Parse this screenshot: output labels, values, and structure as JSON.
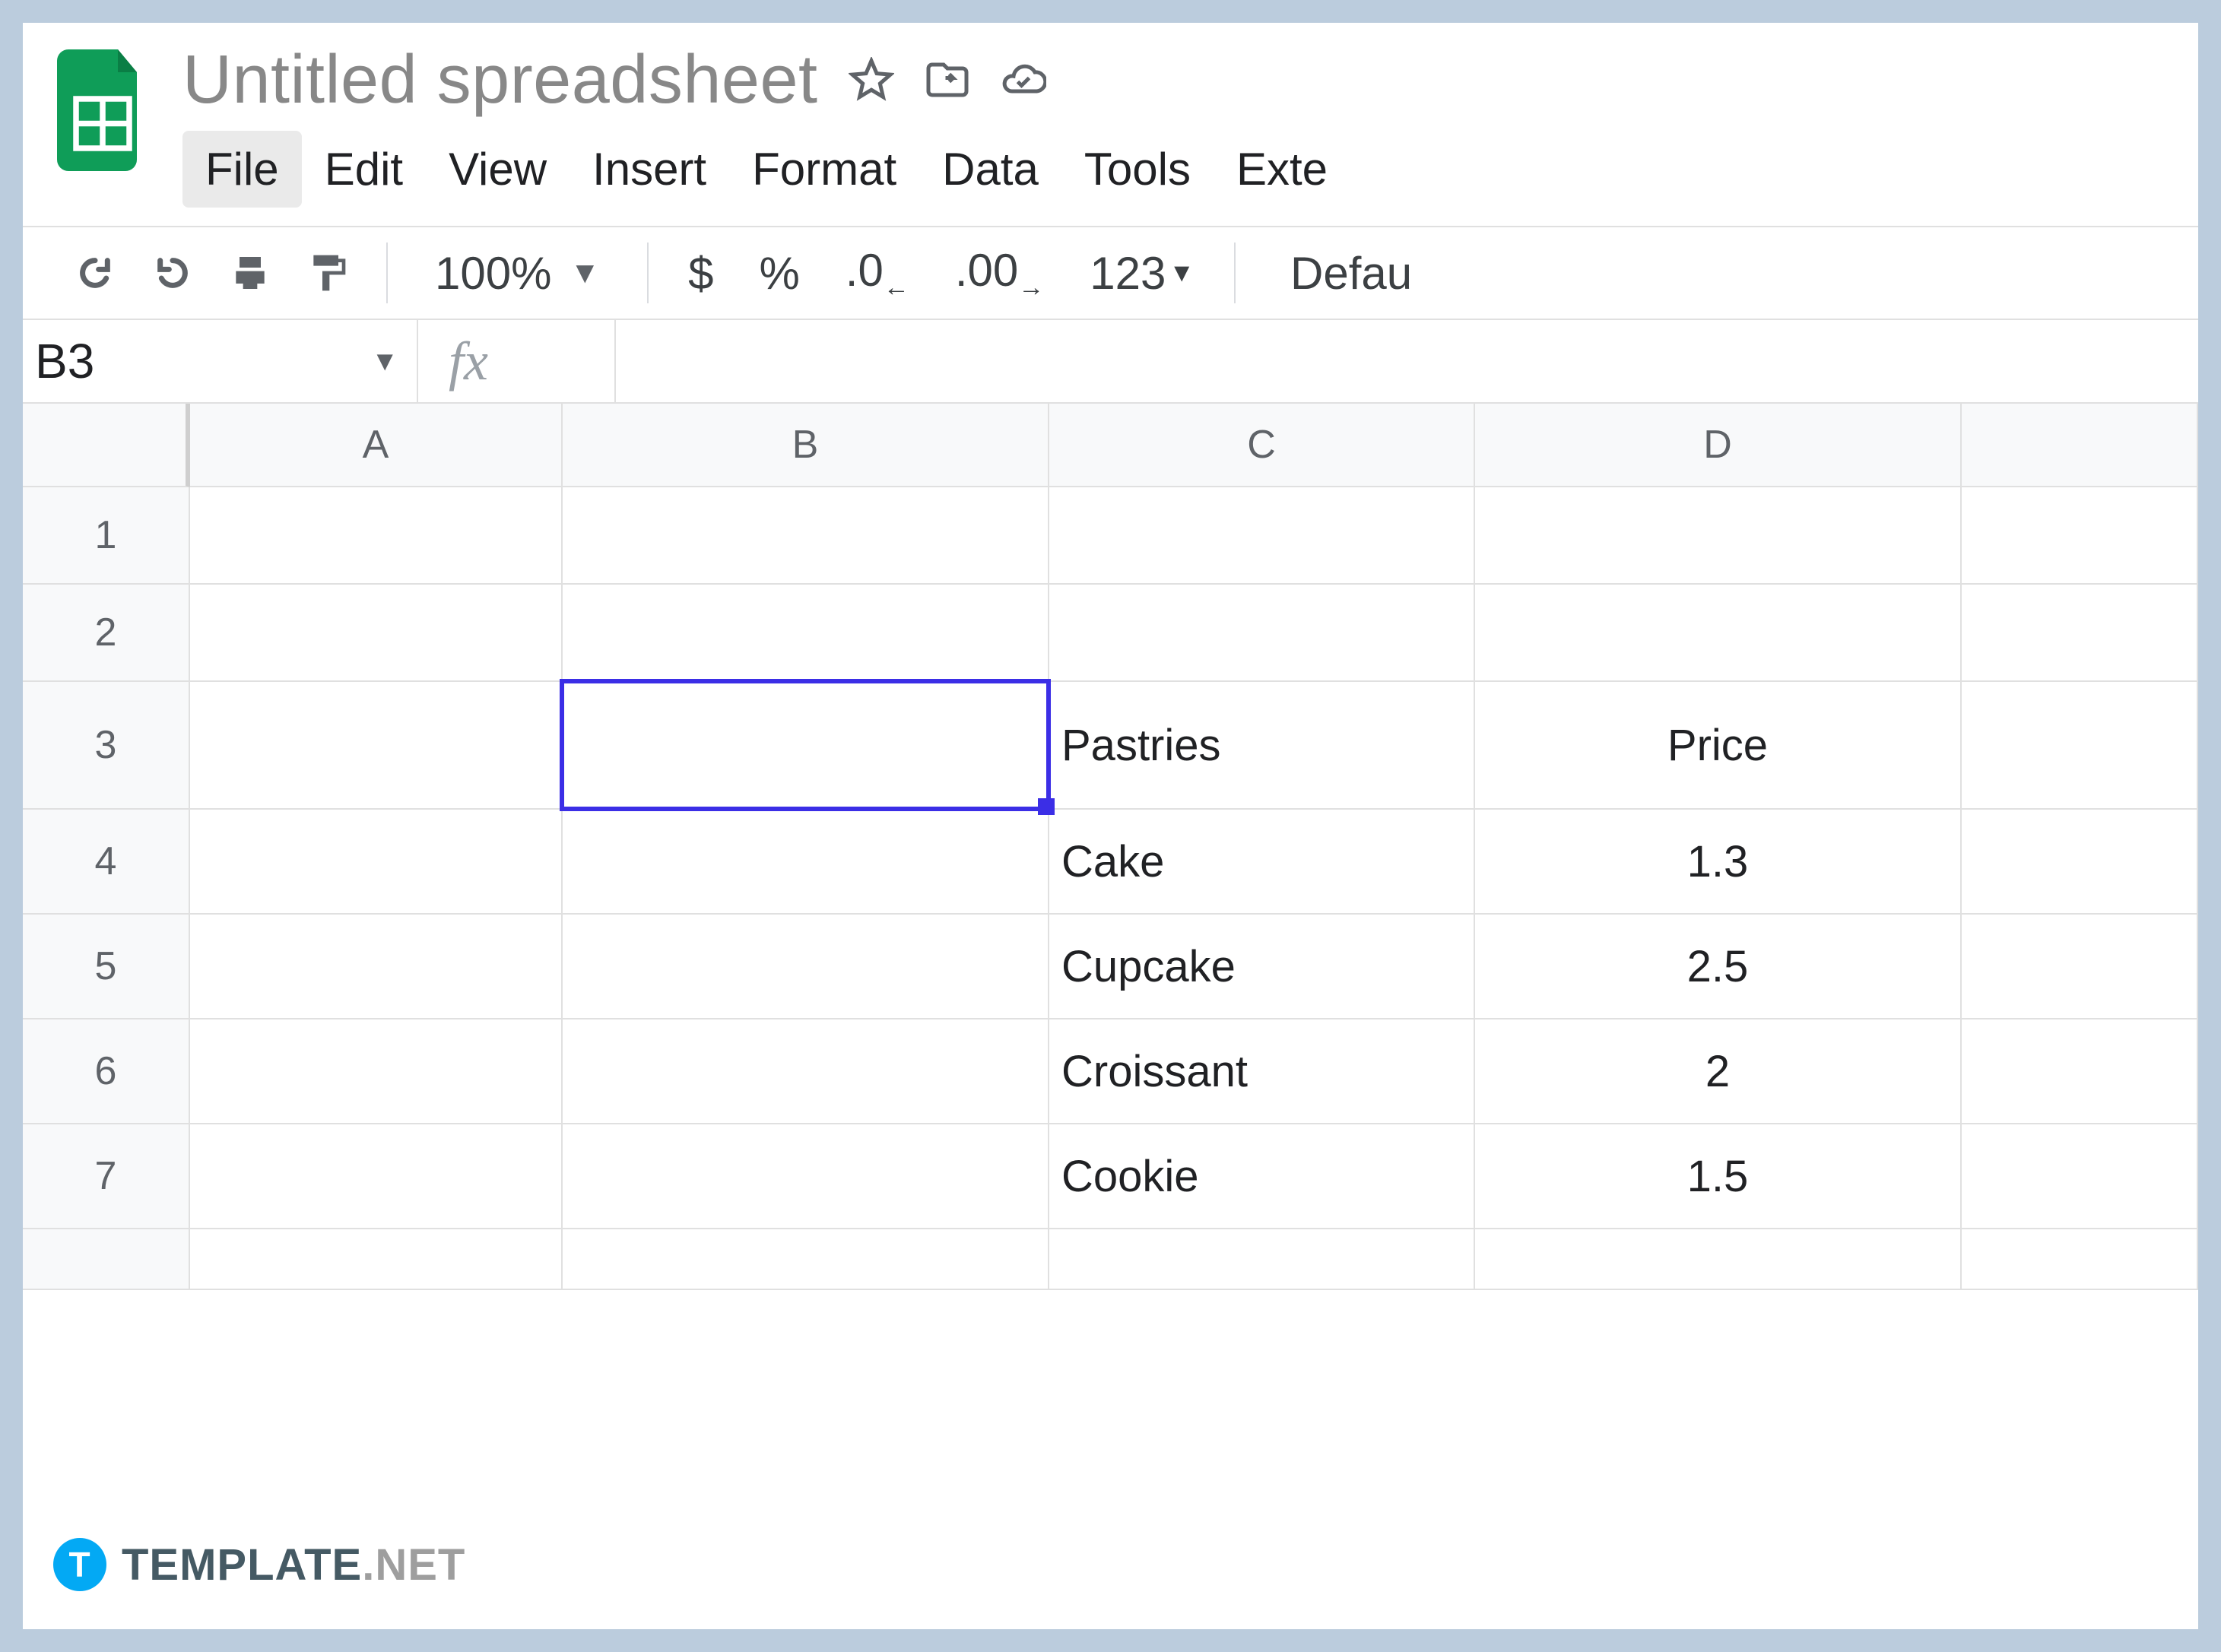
{
  "doc": {
    "title": "Untitled spreadsheet"
  },
  "menu": {
    "items": [
      "File",
      "Edit",
      "View",
      "Insert",
      "Format",
      "Data",
      "Tools",
      "Exte"
    ],
    "hovered_index": 0
  },
  "toolbar": {
    "zoom": "100%",
    "currency": "$",
    "percent": "%",
    "dec_decrease": ".0",
    "dec_increase": ".00",
    "more_formats": "123",
    "font_label": "Defau"
  },
  "namebox": {
    "value": "B3"
  },
  "fx": {
    "label": "fx"
  },
  "grid": {
    "columns": [
      "A",
      "B",
      "C",
      "D"
    ],
    "rows": [
      "1",
      "2",
      "3",
      "4",
      "5",
      "6",
      "7"
    ],
    "selected": {
      "col": "B",
      "row": "3"
    },
    "data": {
      "C3": "Pastries",
      "D3": "Price",
      "C4": "Cake",
      "D4": "1.3",
      "C5": "Cupcake",
      "D5": "2.5",
      "C6": "Croissant",
      "D6": "2",
      "C7": "Cookie",
      "D7": "1.5"
    }
  },
  "watermark": {
    "icon": "T",
    "brand": "TEMPLATE",
    "suffix": ".NET"
  }
}
